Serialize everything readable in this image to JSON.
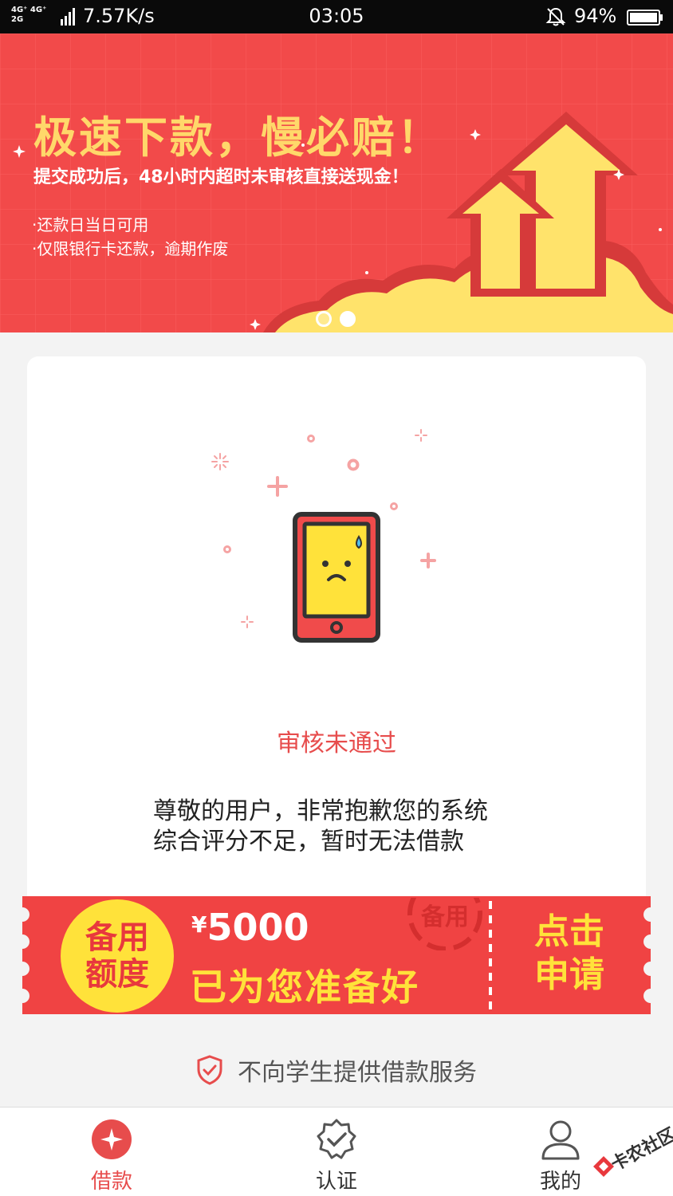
{
  "status_bar": {
    "net_top": "4G⁺ 4G⁺",
    "net_bottom": "2G",
    "speed": "7.57K/s",
    "time": "03:05",
    "battery": "94%"
  },
  "banner": {
    "headline": "极速下款，慢必赔！",
    "subline": "提交成功后，48小时内超时未审核直接送现金！",
    "bullet_1": "·还款日当日可用",
    "bullet_2": "·仅限银行卡还款，逾期作废",
    "page_count": 2,
    "active_page": 2
  },
  "result_card": {
    "title": "审核未通过",
    "message_line_1": "尊敬的用户，非常抱歉您的系统",
    "message_line_2": "综合评分不足，暂时无法借款"
  },
  "coupon": {
    "badge_line_1": "备用",
    "badge_line_2": "额度",
    "currency": "¥",
    "amount": "5000",
    "ready_text": "已为您准备好",
    "stamp_text": "备用",
    "apply_line_1": "点击",
    "apply_line_2": "申请"
  },
  "notice": {
    "text": "不向学生提供借款服务"
  },
  "tabs": [
    {
      "label": "借款",
      "icon": "loan-icon",
      "active": true
    },
    {
      "label": "认证",
      "icon": "verify-badge-icon",
      "active": false
    },
    {
      "label": "我的",
      "icon": "user-icon",
      "active": false
    }
  ],
  "watermark": {
    "text": "卡农社区"
  },
  "colors": {
    "brand_red": "#f24a4a",
    "accent_yellow": "#ffe23a",
    "status_red": "#e74c4c"
  }
}
